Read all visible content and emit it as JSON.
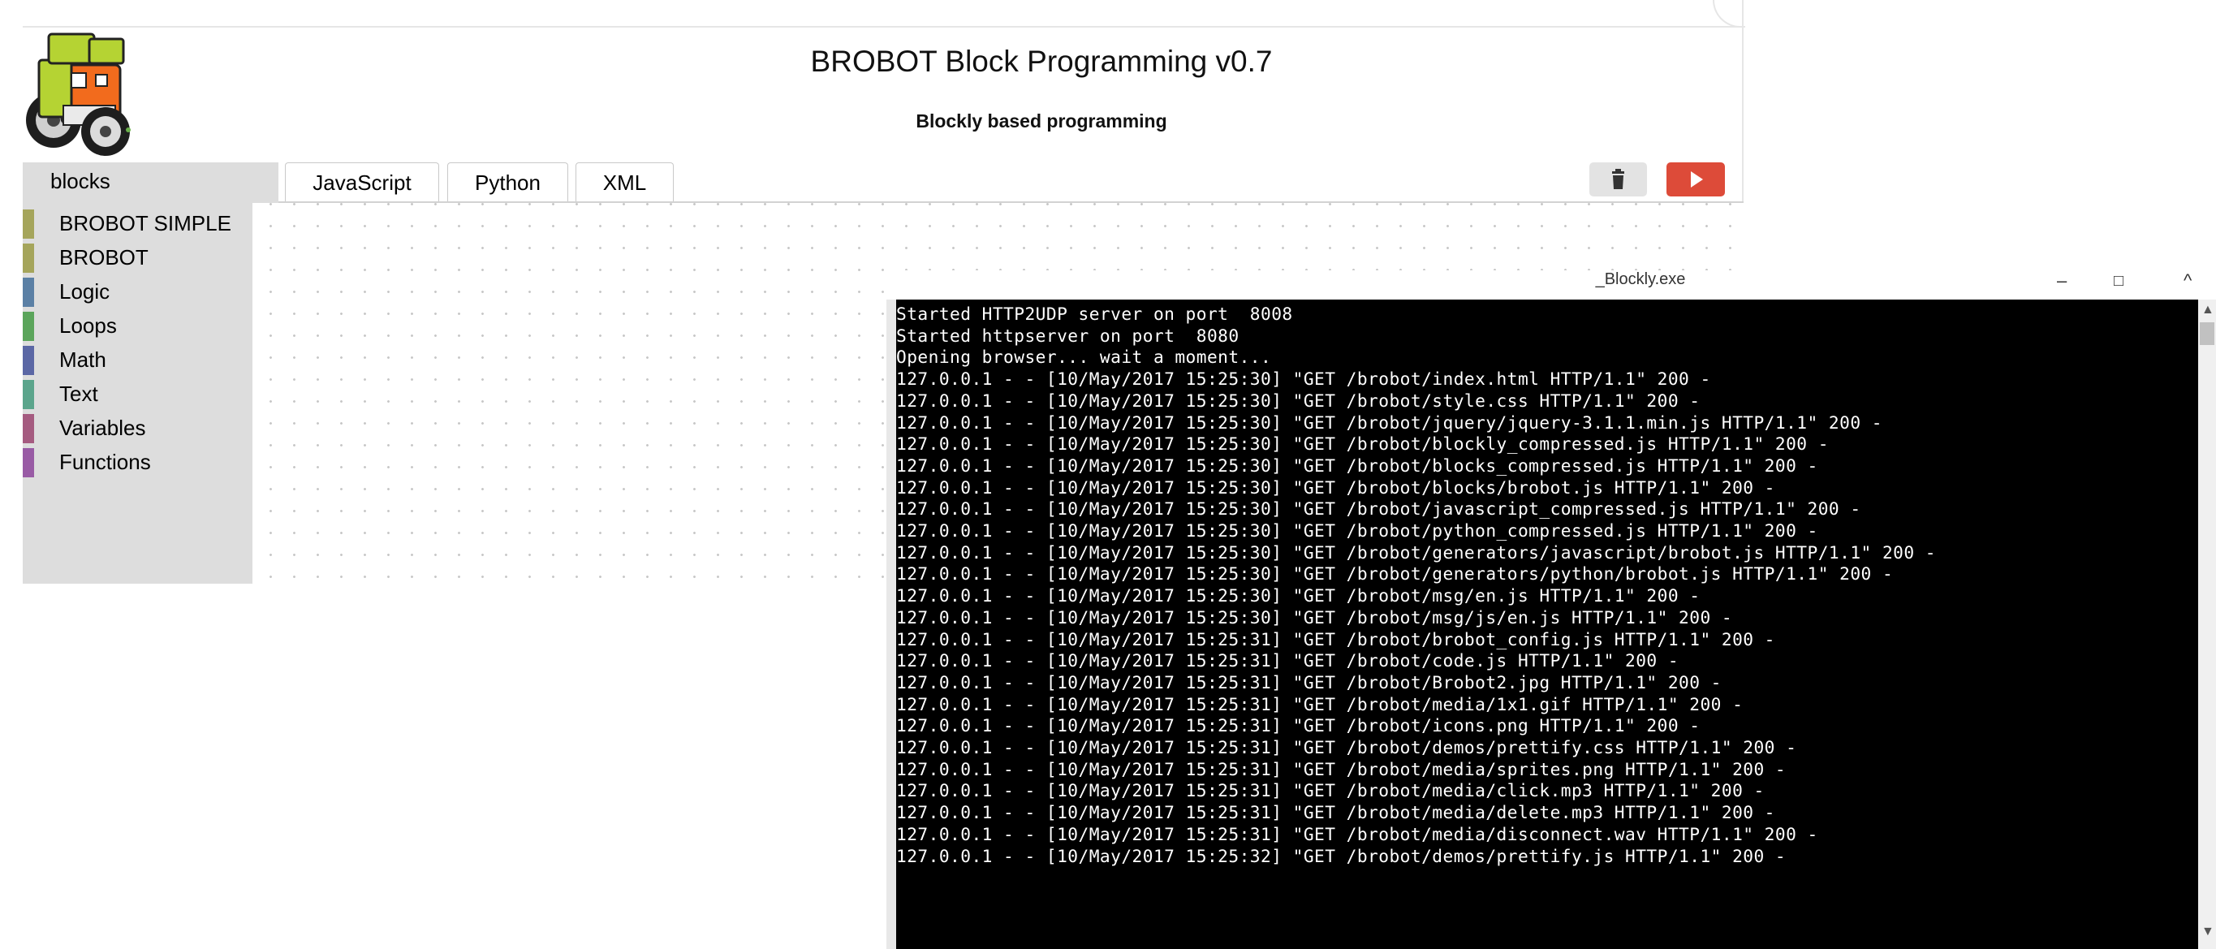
{
  "app": {
    "title": "BROBOT Block Programming v0.7",
    "subtitle": "Blockly based programming",
    "tabs": {
      "blocks": "blocks",
      "javascript": "JavaScript",
      "python": "Python",
      "xml": "XML"
    },
    "toolbox": [
      {
        "label": "BROBOT SIMPLE",
        "color": "#a5a55b"
      },
      {
        "label": "BROBOT",
        "color": "#a5a55b"
      },
      {
        "label": "Logic",
        "color": "#5b80a5"
      },
      {
        "label": "Loops",
        "color": "#5ba55b"
      },
      {
        "label": "Math",
        "color": "#5b67a5"
      },
      {
        "label": "Text",
        "color": "#5ba58c"
      },
      {
        "label": "Variables",
        "color": "#a55b80"
      },
      {
        "label": "Functions",
        "color": "#995ba5"
      }
    ],
    "buttons": {
      "trash_icon": "trash-icon",
      "run_icon": "play-icon",
      "run_color": "#dd4b39"
    }
  },
  "console": {
    "title": "_Blockly.exe",
    "window_controls": {
      "minimize": "–",
      "maximize": "□",
      "close": "^"
    },
    "lines": [
      "Started HTTP2UDP server on port  8008",
      "Started httpserver on port  8080",
      "Opening browser... wait a moment...",
      "127.0.0.1 - - [10/May/2017 15:25:30] \"GET /brobot/index.html HTTP/1.1\" 200 -",
      "127.0.0.1 - - [10/May/2017 15:25:30] \"GET /brobot/style.css HTTP/1.1\" 200 -",
      "127.0.0.1 - - [10/May/2017 15:25:30] \"GET /brobot/jquery/jquery-3.1.1.min.js HTTP/1.1\" 200 -",
      "127.0.0.1 - - [10/May/2017 15:25:30] \"GET /brobot/blockly_compressed.js HTTP/1.1\" 200 -",
      "127.0.0.1 - - [10/May/2017 15:25:30] \"GET /brobot/blocks_compressed.js HTTP/1.1\" 200 -",
      "127.0.0.1 - - [10/May/2017 15:25:30] \"GET /brobot/blocks/brobot.js HTTP/1.1\" 200 -",
      "127.0.0.1 - - [10/May/2017 15:25:30] \"GET /brobot/javascript_compressed.js HTTP/1.1\" 200 -",
      "127.0.0.1 - - [10/May/2017 15:25:30] \"GET /brobot/python_compressed.js HTTP/1.1\" 200 -",
      "127.0.0.1 - - [10/May/2017 15:25:30] \"GET /brobot/generators/javascript/brobot.js HTTP/1.1\" 200 -",
      "127.0.0.1 - - [10/May/2017 15:25:30] \"GET /brobot/generators/python/brobot.js HTTP/1.1\" 200 -",
      "127.0.0.1 - - [10/May/2017 15:25:30] \"GET /brobot/msg/en.js HTTP/1.1\" 200 -",
      "127.0.0.1 - - [10/May/2017 15:25:30] \"GET /brobot/msg/js/en.js HTTP/1.1\" 200 -",
      "127.0.0.1 - - [10/May/2017 15:25:31] \"GET /brobot/brobot_config.js HTTP/1.1\" 200 -",
      "127.0.0.1 - - [10/May/2017 15:25:31] \"GET /brobot/code.js HTTP/1.1\" 200 -",
      "127.0.0.1 - - [10/May/2017 15:25:31] \"GET /brobot/Brobot2.jpg HTTP/1.1\" 200 -",
      "127.0.0.1 - - [10/May/2017 15:25:31] \"GET /brobot/media/1x1.gif HTTP/1.1\" 200 -",
      "127.0.0.1 - - [10/May/2017 15:25:31] \"GET /brobot/icons.png HTTP/1.1\" 200 -",
      "127.0.0.1 - - [10/May/2017 15:25:31] \"GET /brobot/demos/prettify.css HTTP/1.1\" 200 -",
      "127.0.0.1 - - [10/May/2017 15:25:31] \"GET /brobot/media/sprites.png HTTP/1.1\" 200 -",
      "127.0.0.1 - - [10/May/2017 15:25:31] \"GET /brobot/media/click.mp3 HTTP/1.1\" 200 -",
      "127.0.0.1 - - [10/May/2017 15:25:31] \"GET /brobot/media/delete.mp3 HTTP/1.1\" 200 -",
      "127.0.0.1 - - [10/May/2017 15:25:31] \"GET /brobot/media/disconnect.wav HTTP/1.1\" 200 -",
      "127.0.0.1 - - [10/May/2017 15:25:32] \"GET /brobot/demos/prettify.js HTTP/1.1\" 200 -"
    ]
  }
}
